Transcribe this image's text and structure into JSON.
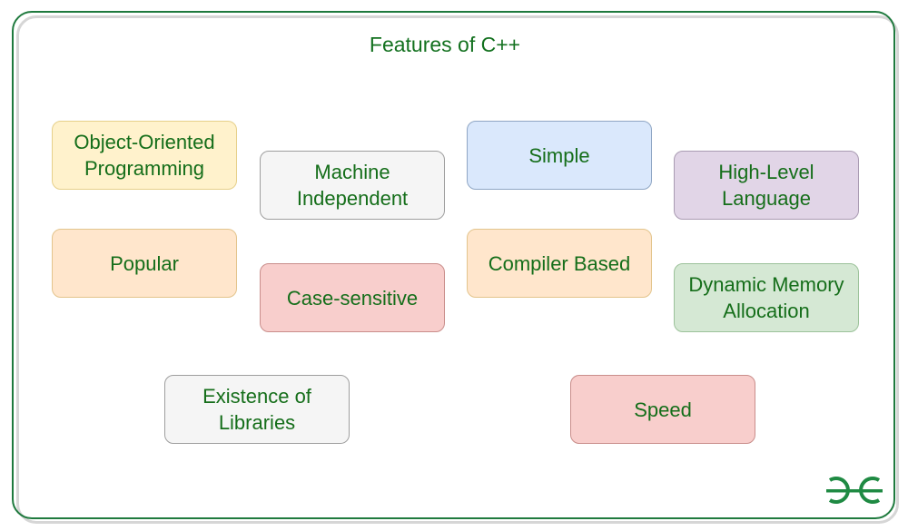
{
  "title": "Features of C++",
  "features": [
    {
      "label": "Object-Oriented\nProgramming",
      "fill": "#fff2cc",
      "stroke": "#e6d08a"
    },
    {
      "label": "Machine\nIndependent",
      "fill": "#f5f5f5",
      "stroke": "#9e9e9e"
    },
    {
      "label": "Simple",
      "fill": "#dae8fc",
      "stroke": "#8fa6c4"
    },
    {
      "label": "High-Level\nLanguage",
      "fill": "#e1d5e7",
      "stroke": "#a99bb2"
    },
    {
      "label": "Popular",
      "fill": "#ffe6cc",
      "stroke": "#e3c48c"
    },
    {
      "label": "Case-sensitive",
      "fill": "#f8cecc",
      "stroke": "#c98e8b"
    },
    {
      "label": "Compiler Based",
      "fill": "#ffe6cc",
      "stroke": "#e3c48c"
    },
    {
      "label": "Dynamic Memory\nAllocation",
      "fill": "#d5e8d4",
      "stroke": "#9cc29a"
    },
    {
      "label": "Existence of\nLibraries",
      "fill": "#f5f5f5",
      "stroke": "#9e9e9e"
    },
    {
      "label": "Speed",
      "fill": "#f8cecc",
      "stroke": "#c98e8b"
    }
  ],
  "logo": {
    "name": "GG",
    "color": "#1f8a43"
  }
}
